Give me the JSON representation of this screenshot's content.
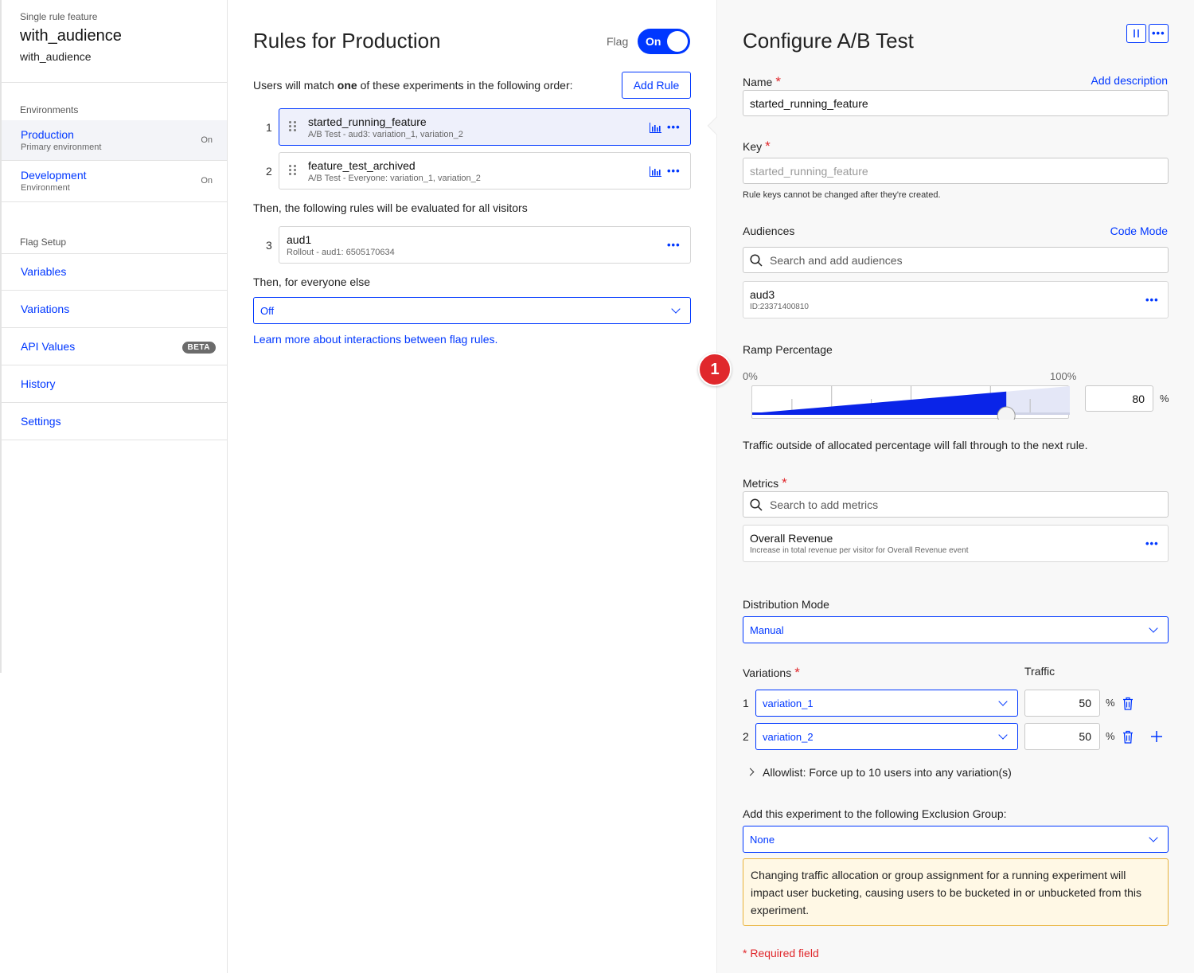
{
  "sidebar": {
    "kicker": "Single rule feature",
    "title": "with_audience",
    "subtitle": "with_audience",
    "environments_heading": "Environments",
    "environments": [
      {
        "name": "Production",
        "description": "Primary environment",
        "state": "On",
        "active": true
      },
      {
        "name": "Development",
        "description": "Environment",
        "state": "On",
        "active": false
      }
    ],
    "flag_setup_heading": "Flag Setup",
    "nav": [
      {
        "label": "Variables"
      },
      {
        "label": "Variations"
      },
      {
        "label": "API Values",
        "badge": "BETA"
      },
      {
        "label": "History"
      },
      {
        "label": "Settings"
      }
    ]
  },
  "rules": {
    "title": "Rules for Production",
    "flag_label": "Flag",
    "flag_toggle": "On",
    "intro_before": "Users will match ",
    "intro_bold": "one",
    "intro_after": " of these experiments in the following order:",
    "add_rule": "Add Rule",
    "experiments": [
      {
        "num": "1",
        "name": "started_running_feature",
        "sub": "A/B Test - aud3: variation_1, variation_2"
      },
      {
        "num": "2",
        "name": "feature_test_archived",
        "sub": "A/B Test - Everyone: variation_1, variation_2"
      }
    ],
    "then_text": "Then, the following rules will be evaluated for all visitors",
    "rollouts": [
      {
        "num": "3",
        "name": "aud1",
        "sub": "Rollout - aud1: 6505170634"
      }
    ],
    "everyone_text": "Then, for everyone else",
    "everyone_value": "Off",
    "learn_more": "Learn more about interactions between flag rules."
  },
  "config": {
    "title": "Configure A/B Test",
    "name_label": "Name",
    "add_description": "Add description",
    "name_value": "started_running_feature",
    "key_label": "Key",
    "key_value": "started_running_feature",
    "key_help": "Rule keys cannot be changed after they're created.",
    "audiences_label": "Audiences",
    "code_mode": "Code Mode",
    "audience_search_placeholder": "Search and add audiences",
    "audience": {
      "name": "aud3",
      "id": "ID:23371400810"
    },
    "step_badge": "1",
    "ramp_label": "Ramp Percentage",
    "ramp_min": "0%",
    "ramp_max": "100%",
    "ramp_value": "80",
    "ramp_fraction": 0.8,
    "percent_sign": "%",
    "ramp_help": "Traffic outside of allocated percentage will fall through to the next rule.",
    "metrics_label": "Metrics",
    "metrics_search_placeholder": "Search to add metrics",
    "metric": {
      "name": "Overall Revenue",
      "desc": "Increase in total revenue per visitor for Overall Revenue event"
    },
    "distribution_label": "Distribution Mode",
    "distribution_value": "Manual",
    "variations_label": "Variations",
    "traffic_label": "Traffic",
    "variations": [
      {
        "num": "1",
        "name": "variation_1",
        "traffic": "50"
      },
      {
        "num": "2",
        "name": "variation_2",
        "traffic": "50"
      }
    ],
    "allowlist": "Allowlist: Force up to 10 users into any variation(s)",
    "exclusion_label": "Add this experiment to the following Exclusion Group:",
    "exclusion_value": "None",
    "warning": "Changing traffic allocation or group assignment for a running experiment will impact user bucketing, causing users to be bucketed in or unbucketed from this experiment.",
    "required_note": "* Required field"
  },
  "colors": {
    "accent": "#0037ff",
    "required": "#e0282c",
    "warning_border": "#e8b23a",
    "warning_bg": "#fff8e5"
  },
  "icons": [
    "search-icon",
    "grip-icon",
    "results-chart-icon",
    "more-dots-icon",
    "chevron-down-icon",
    "chevron-right-icon",
    "trash-icon",
    "plus-icon",
    "split-view-icon"
  ]
}
